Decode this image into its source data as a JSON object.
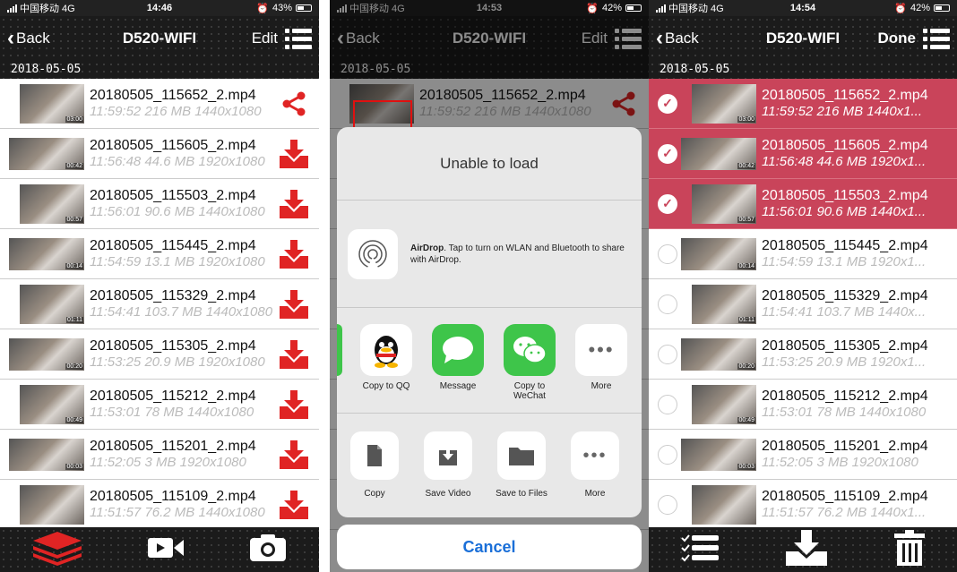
{
  "screens": [
    {
      "status": {
        "carrier": "中国移动 4G",
        "time": "14:46",
        "battery": "43%"
      },
      "nav": {
        "back": "Back",
        "title": "D520-WIFI",
        "right": "Edit"
      },
      "section": "2018-05-05",
      "rows": [
        {
          "name": "20180505_115652_2.mp4",
          "detail": "11:59:52 216 MB 1440x1080",
          "dur": "03:00"
        },
        {
          "name": "20180505_115605_2.mp4",
          "detail": "11:56:48 44.6 MB 1920x1080",
          "dur": "00:42"
        },
        {
          "name": "20180505_115503_2.mp4",
          "detail": "11:56:01 90.6 MB 1440x1080",
          "dur": "00:57"
        },
        {
          "name": "20180505_115445_2.mp4",
          "detail": "11:54:59 13.1 MB 1920x1080",
          "dur": "00:14"
        },
        {
          "name": "20180505_115329_2.mp4",
          "detail": "11:54:41 103.7 MB 1440x1080",
          "dur": "01:11"
        },
        {
          "name": "20180505_115305_2.mp4",
          "detail": "11:53:25 20.9 MB 1920x1080",
          "dur": "00:20"
        },
        {
          "name": "20180505_115212_2.mp4",
          "detail": "11:53:01 78 MB 1440x1080",
          "dur": "00:49"
        },
        {
          "name": "20180505_115201_2.mp4",
          "detail": "11:52:05 3 MB 1920x1080",
          "dur": "00:03"
        },
        {
          "name": "20180505_115109_2.mp4",
          "detail": "11:51:57 76.2 MB 1440x1080",
          "dur": ""
        }
      ]
    },
    {
      "status": {
        "carrier": "中国移动 4G",
        "time": "14:53",
        "battery": "42%"
      },
      "nav": {
        "back": "Back",
        "title": "D520-WIFI",
        "right": "Edit"
      },
      "section": "2018-05-05",
      "row": {
        "name": "20180505_115652_2.mp4",
        "detail": "11:59:52 216 MB 1440x1080"
      },
      "sheet": {
        "header": "Unable to load",
        "airdrop_bold": "AirDrop",
        "airdrop_text": ". Tap to turn on WLAN and Bluetooth to share with AirDrop.",
        "apps": [
          "Copy to QQ",
          "Message",
          "Copy to WeChat",
          "More"
        ],
        "actions": [
          "Copy",
          "Save Video",
          "Save to Files",
          "More"
        ],
        "cancel": "Cancel"
      }
    },
    {
      "status": {
        "carrier": "中国移动 4G",
        "time": "14:54",
        "battery": "42%"
      },
      "nav": {
        "back": "Back",
        "title": "D520-WIFI",
        "right": "Done"
      },
      "section": "2018-05-05",
      "rows": [
        {
          "name": "20180505_115652_2.mp4",
          "detail": "11:59:52 216 MB 1440x1...",
          "dur": "03:00",
          "selected": true
        },
        {
          "name": "20180505_115605_2.mp4",
          "detail": "11:56:48 44.6 MB 1920x1...",
          "dur": "00:42",
          "selected": true
        },
        {
          "name": "20180505_115503_2.mp4",
          "detail": "11:56:01 90.6 MB 1440x1...",
          "dur": "00:57",
          "selected": true
        },
        {
          "name": "20180505_115445_2.mp4",
          "detail": "11:54:59 13.1 MB 1920x1...",
          "dur": "00:14",
          "selected": false
        },
        {
          "name": "20180505_115329_2.mp4",
          "detail": "11:54:41 103.7 MB 1440x...",
          "dur": "01:11",
          "selected": false
        },
        {
          "name": "20180505_115305_2.mp4",
          "detail": "11:53:25 20.9 MB 1920x1...",
          "dur": "00:20",
          "selected": false
        },
        {
          "name": "20180505_115212_2.mp4",
          "detail": "11:53:01 78 MB 1440x1080",
          "dur": "00:49",
          "selected": false
        },
        {
          "name": "20180505_115201_2.mp4",
          "detail": "11:52:05 3 MB 1920x1080",
          "dur": "00:03",
          "selected": false
        },
        {
          "name": "20180505_115109_2.mp4",
          "detail": "11:51:57 76.2 MB 1440x1...",
          "dur": "",
          "selected": false
        }
      ]
    }
  ],
  "colors": {
    "accent_red": "#e02424",
    "selected_row": "#c9445a",
    "ios_blue": "#1a6fd8"
  }
}
